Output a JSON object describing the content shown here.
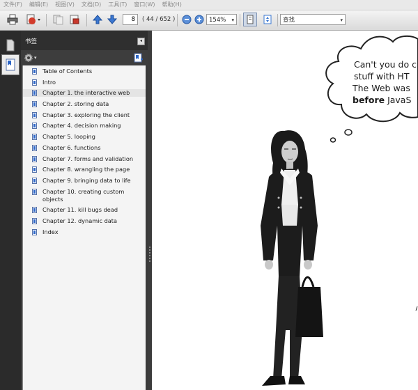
{
  "menu": [
    "文件(F)",
    "编辑(E)",
    "视图(V)",
    "文档(D)",
    "工具(T)",
    "窗口(W)",
    "帮助(H)"
  ],
  "toolbar": {
    "page_number": "8",
    "page_count": "( 44 / 652 )",
    "zoom": "154%",
    "search_placeholder": "查找"
  },
  "panel": {
    "title": "书签"
  },
  "bookmarks": [
    {
      "label": "Table of Contents"
    },
    {
      "label": "Intro"
    },
    {
      "label": "Chapter 1. the interactive web"
    },
    {
      "label": "Chapter 2. storing data"
    },
    {
      "label": "Chapter 3. exploring the client"
    },
    {
      "label": "Chapter 4. decision making"
    },
    {
      "label": "Chapter 5. looping"
    },
    {
      "label": "Chapter 6. functions"
    },
    {
      "label": "Chapter 7. forms and validation"
    },
    {
      "label": "Chapter 8. wrangling the page"
    },
    {
      "label": "Chapter 9. bringing data to life"
    },
    {
      "label": "Chapter 10. creating custom objects"
    },
    {
      "label": "Chapter 11. kill bugs dead"
    },
    {
      "label": "Chapter 12. dynamic data"
    },
    {
      "label": "Index"
    }
  ],
  "selected_bookmark": "Chapter 1. the interactive web",
  "document": {
    "bubble_line1": "Can't you do c",
    "bubble_line2": "stuff with HT",
    "bubble_line3": "The Web was",
    "bubble_line4_bold": "before",
    "bubble_line4_rest": " JavaS"
  },
  "colors": {
    "accent_blue": "#2c66c8",
    "panel_dark": "#3a3a3a",
    "page_bg": "#ffffff"
  }
}
